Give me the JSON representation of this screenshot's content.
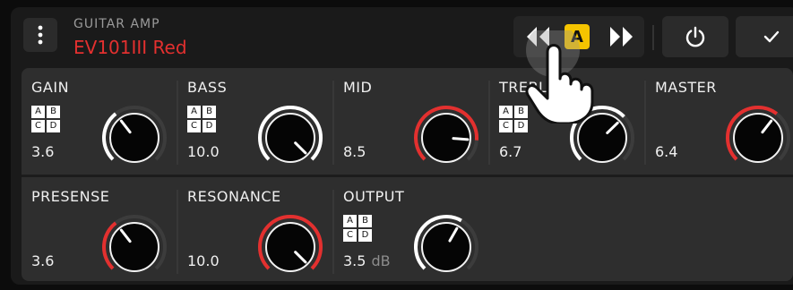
{
  "header": {
    "subtitle": "GUITAR AMP",
    "title": "EV101III Red",
    "ab_label": "A"
  },
  "colors": {
    "accent_red": "#e3302f",
    "ab_yellow": "#f5c400",
    "panel": "#2e2e2e"
  },
  "icons": {
    "menu": "more-vertical-icon",
    "prev": "double-chevron-left-icon",
    "next": "double-chevron-right-icon",
    "power": "power-icon",
    "confirm": "check-icon",
    "pointer": "hand-pointer-icon"
  },
  "controls": [
    {
      "id": "gain",
      "label": "GAIN",
      "value": "3.6",
      "unit": "",
      "level": 0.36,
      "accent": false,
      "abcd": [
        "A",
        "B",
        "C",
        "D"
      ]
    },
    {
      "id": "bass",
      "label": "BASS",
      "value": "10.0",
      "unit": "",
      "level": 1.0,
      "accent": false,
      "abcd": [
        "A",
        "B",
        "C",
        "D"
      ]
    },
    {
      "id": "mid",
      "label": "MID",
      "value": "8.5",
      "unit": "",
      "level": 0.85,
      "accent": true,
      "abcd": []
    },
    {
      "id": "treble",
      "label": "TREBLE",
      "value": "6.7",
      "unit": "",
      "level": 0.67,
      "accent": false,
      "abcd": [
        "A",
        "B",
        "C",
        "D"
      ]
    },
    {
      "id": "master",
      "label": "MASTER",
      "value": "6.4",
      "unit": "",
      "level": 0.64,
      "accent": true,
      "abcd": []
    },
    {
      "id": "presense",
      "label": "PRESENSE",
      "value": "3.6",
      "unit": "",
      "level": 0.36,
      "accent": true,
      "abcd": []
    },
    {
      "id": "resonance",
      "label": "RESONANCE",
      "value": "10.0",
      "unit": "",
      "level": 1.0,
      "accent": true,
      "abcd": []
    },
    {
      "id": "output",
      "label": "OUTPUT",
      "value": "3.5",
      "unit": "dB",
      "level": 0.61,
      "accent": false,
      "abcd": [
        "A",
        "B",
        "C",
        "D"
      ]
    }
  ]
}
